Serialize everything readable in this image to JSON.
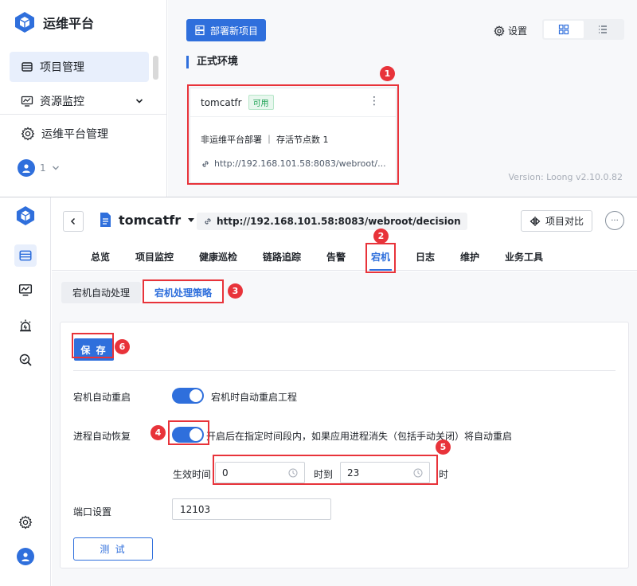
{
  "top": {
    "app_title": "运维平台",
    "sidebar": {
      "items": [
        {
          "label": "项目管理",
          "icon": "project-icon"
        },
        {
          "label": "资源监控",
          "icon": "monitor-icon"
        },
        {
          "label": "运维平台管理",
          "icon": "gear-icon"
        }
      ],
      "user_label": "1"
    },
    "deploy_button": "部署新项目",
    "settings_label": "设置",
    "env_title": "正式环境",
    "card": {
      "name": "tomcatfr",
      "status": "可用",
      "line1": "非运维平台部署 ｜ 存活节点数 1",
      "url": "http://192.168.101.58:8083/webroot/..."
    },
    "version": "Version: Loong v2.10.0.82"
  },
  "bottom": {
    "project_name": "tomcatfr",
    "url": "http://192.168.101.58:8083/webroot/decision",
    "compare_button": "项目对比",
    "more_button": "···",
    "tabs": [
      "总览",
      "项目监控",
      "健康巡检",
      "链路追踪",
      "告警",
      "宕机",
      "日志",
      "维护",
      "业务工具"
    ],
    "active_tab": "宕机",
    "subtabs": [
      "宕机自动处理",
      "宕机处理策略"
    ],
    "form": {
      "save_button": "保 存",
      "auto_restart_label": "宕机自动重启",
      "auto_restart_desc": "宕机时自动重启工程",
      "auto_recover_label": "进程自动恢复",
      "auto_recover_desc": "开启后在指定时间段内，如果应用进程消失（包括手动关闭）将自动重启",
      "effective_time_label": "生效时间",
      "time_from": "0",
      "time_to_label": "时到",
      "time_to": "23",
      "time_suffix": "时",
      "port_label": "端口设置",
      "port_value": "12103",
      "test_button": "测 试"
    }
  },
  "annotations": [
    "1",
    "2",
    "3",
    "4",
    "5",
    "6"
  ],
  "colors": {
    "accent": "#2f6fdc",
    "annotation": "#e8333a",
    "status_ok": "#23a559"
  }
}
